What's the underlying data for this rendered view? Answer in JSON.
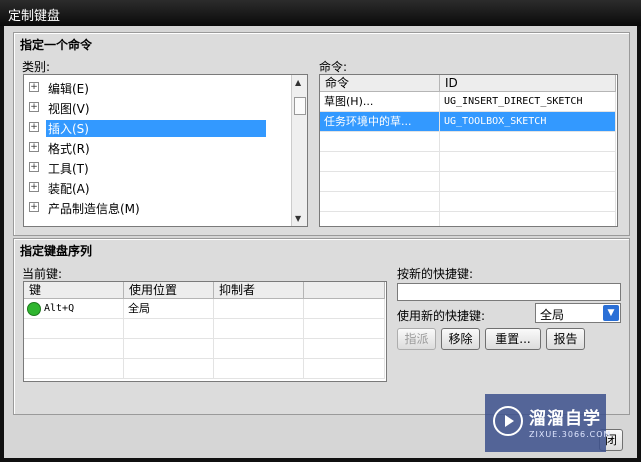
{
  "window": {
    "title": "定制键盘"
  },
  "command_group": {
    "title": "指定一个命令",
    "category_label": "类别:",
    "categories": [
      {
        "label": "编辑(E)",
        "selected": false
      },
      {
        "label": "视图(V)",
        "selected": false
      },
      {
        "label": "插入(S)",
        "selected": true
      },
      {
        "label": "格式(R)",
        "selected": false
      },
      {
        "label": "工具(T)",
        "selected": false
      },
      {
        "label": "装配(A)",
        "selected": false
      },
      {
        "label": "产品制造信息(M)",
        "selected": false
      }
    ],
    "commands_label": "命令:",
    "commands_columns": [
      "命令",
      "ID"
    ],
    "commands_rows": [
      {
        "command": "草图(H)...",
        "id": "UG_INSERT_DIRECT_SKETCH",
        "selected": false
      },
      {
        "command": "任务环境中的草...",
        "id": "UG_TOOLBOX_SKETCH",
        "selected": true
      }
    ]
  },
  "sequence_group": {
    "title": "指定键盘序列",
    "current_keys_label": "当前键:",
    "columns": [
      "键",
      "使用位置",
      "抑制者",
      ""
    ],
    "rows": [
      {
        "key": "Alt+Q",
        "location": "全局",
        "suppressor": "",
        "status_color": "#2fb52f"
      }
    ],
    "new_shortcut_label": "按新的快捷键:",
    "new_shortcut_value": "",
    "use_new_label": "使用新的快捷键:",
    "use_new_value": "全局",
    "buttons": {
      "assign": "指派",
      "remove": "移除",
      "reset": "重置...",
      "report": "报告"
    }
  },
  "footer": {
    "close_label": "闭"
  },
  "watermark": {
    "name": "溜溜自学",
    "url": "ZIXUE.3066.COM"
  },
  "icons": {
    "expand": "plus-box-icon",
    "dropdown": "chevron-down-icon",
    "status": "green-circle-icon",
    "scroll_up": "arrow-up-icon",
    "scroll_down": "arrow-down-icon"
  }
}
